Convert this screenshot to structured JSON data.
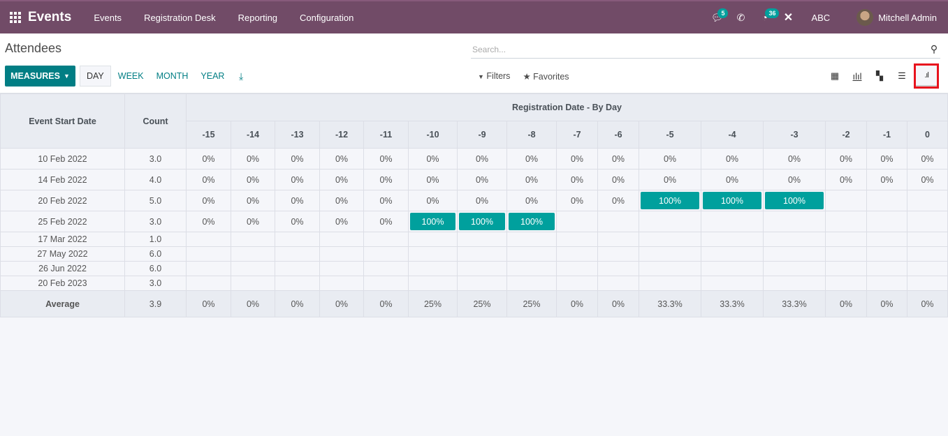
{
  "navbar": {
    "app_name": "Events",
    "menu": [
      "Events",
      "Registration Desk",
      "Reporting",
      "Configuration"
    ],
    "messages_count": "5",
    "activities_count": "36",
    "company": "ABC",
    "user": "Mitchell Admin"
  },
  "control": {
    "title": "Attendees",
    "search_placeholder": "Search...",
    "measures_label": "MEASURES",
    "intervals": [
      "DAY",
      "WEEK",
      "MONTH",
      "YEAR"
    ],
    "active_interval": "DAY",
    "filters_label": "Filters",
    "favorites_label": "Favorites",
    "views": [
      "pivot",
      "graph",
      "kanban",
      "list",
      "cohort"
    ],
    "active_view": "cohort"
  },
  "colors": {
    "brand": "#714b67",
    "accent": "#017e84",
    "cohort_fill": "#00a09d",
    "highlight": "#e8121d"
  },
  "cohort": {
    "row_header": "Event Start Date",
    "count_header": "Count",
    "group_header": "Registration Date - By Day",
    "columns": [
      "-15",
      "-14",
      "-13",
      "-12",
      "-11",
      "-10",
      "-9",
      "-8",
      "-7",
      "-6",
      "-5",
      "-4",
      "-3",
      "-2",
      "-1",
      "0"
    ],
    "rows": [
      {
        "date": "10 Feb 2022",
        "count": "3.0",
        "values": [
          "0%",
          "0%",
          "0%",
          "0%",
          "0%",
          "0%",
          "0%",
          "0%",
          "0%",
          "0%",
          "0%",
          "0%",
          "0%",
          "0%",
          "0%",
          "0%"
        ]
      },
      {
        "date": "14 Feb 2022",
        "count": "4.0",
        "values": [
          "0%",
          "0%",
          "0%",
          "0%",
          "0%",
          "0%",
          "0%",
          "0%",
          "0%",
          "0%",
          "0%",
          "0%",
          "0%",
          "0%",
          "0%",
          "0%"
        ]
      },
      {
        "date": "20 Feb 2022",
        "count": "5.0",
        "values": [
          "0%",
          "0%",
          "0%",
          "0%",
          "0%",
          "0%",
          "0%",
          "0%",
          "0%",
          "0%",
          "100%",
          "100%",
          "100%",
          "",
          "",
          ""
        ]
      },
      {
        "date": "25 Feb 2022",
        "count": "3.0",
        "values": [
          "0%",
          "0%",
          "0%",
          "0%",
          "0%",
          "100%",
          "100%",
          "100%",
          "",
          "",
          "",
          "",
          "",
          "",
          "",
          ""
        ]
      },
      {
        "date": "17 Mar 2022",
        "count": "1.0",
        "values": [
          "",
          "",
          "",
          "",
          "",
          "",
          "",
          "",
          "",
          "",
          "",
          "",
          "",
          "",
          "",
          ""
        ]
      },
      {
        "date": "27 May 2022",
        "count": "6.0",
        "values": [
          "",
          "",
          "",
          "",
          "",
          "",
          "",
          "",
          "",
          "",
          "",
          "",
          "",
          "",
          "",
          ""
        ]
      },
      {
        "date": "26 Jun 2022",
        "count": "6.0",
        "values": [
          "",
          "",
          "",
          "",
          "",
          "",
          "",
          "",
          "",
          "",
          "",
          "",
          "",
          "",
          "",
          ""
        ]
      },
      {
        "date": "20 Feb 2023",
        "count": "3.0",
        "values": [
          "",
          "",
          "",
          "",
          "",
          "",
          "",
          "",
          "",
          "",
          "",
          "",
          "",
          "",
          "",
          ""
        ]
      }
    ],
    "average": {
      "label": "Average",
      "count": "3.9",
      "values": [
        "0%",
        "0%",
        "0%",
        "0%",
        "0%",
        "25%",
        "25%",
        "25%",
        "0%",
        "0%",
        "33.3%",
        "33.3%",
        "33.3%",
        "0%",
        "0%",
        "0%"
      ]
    }
  }
}
